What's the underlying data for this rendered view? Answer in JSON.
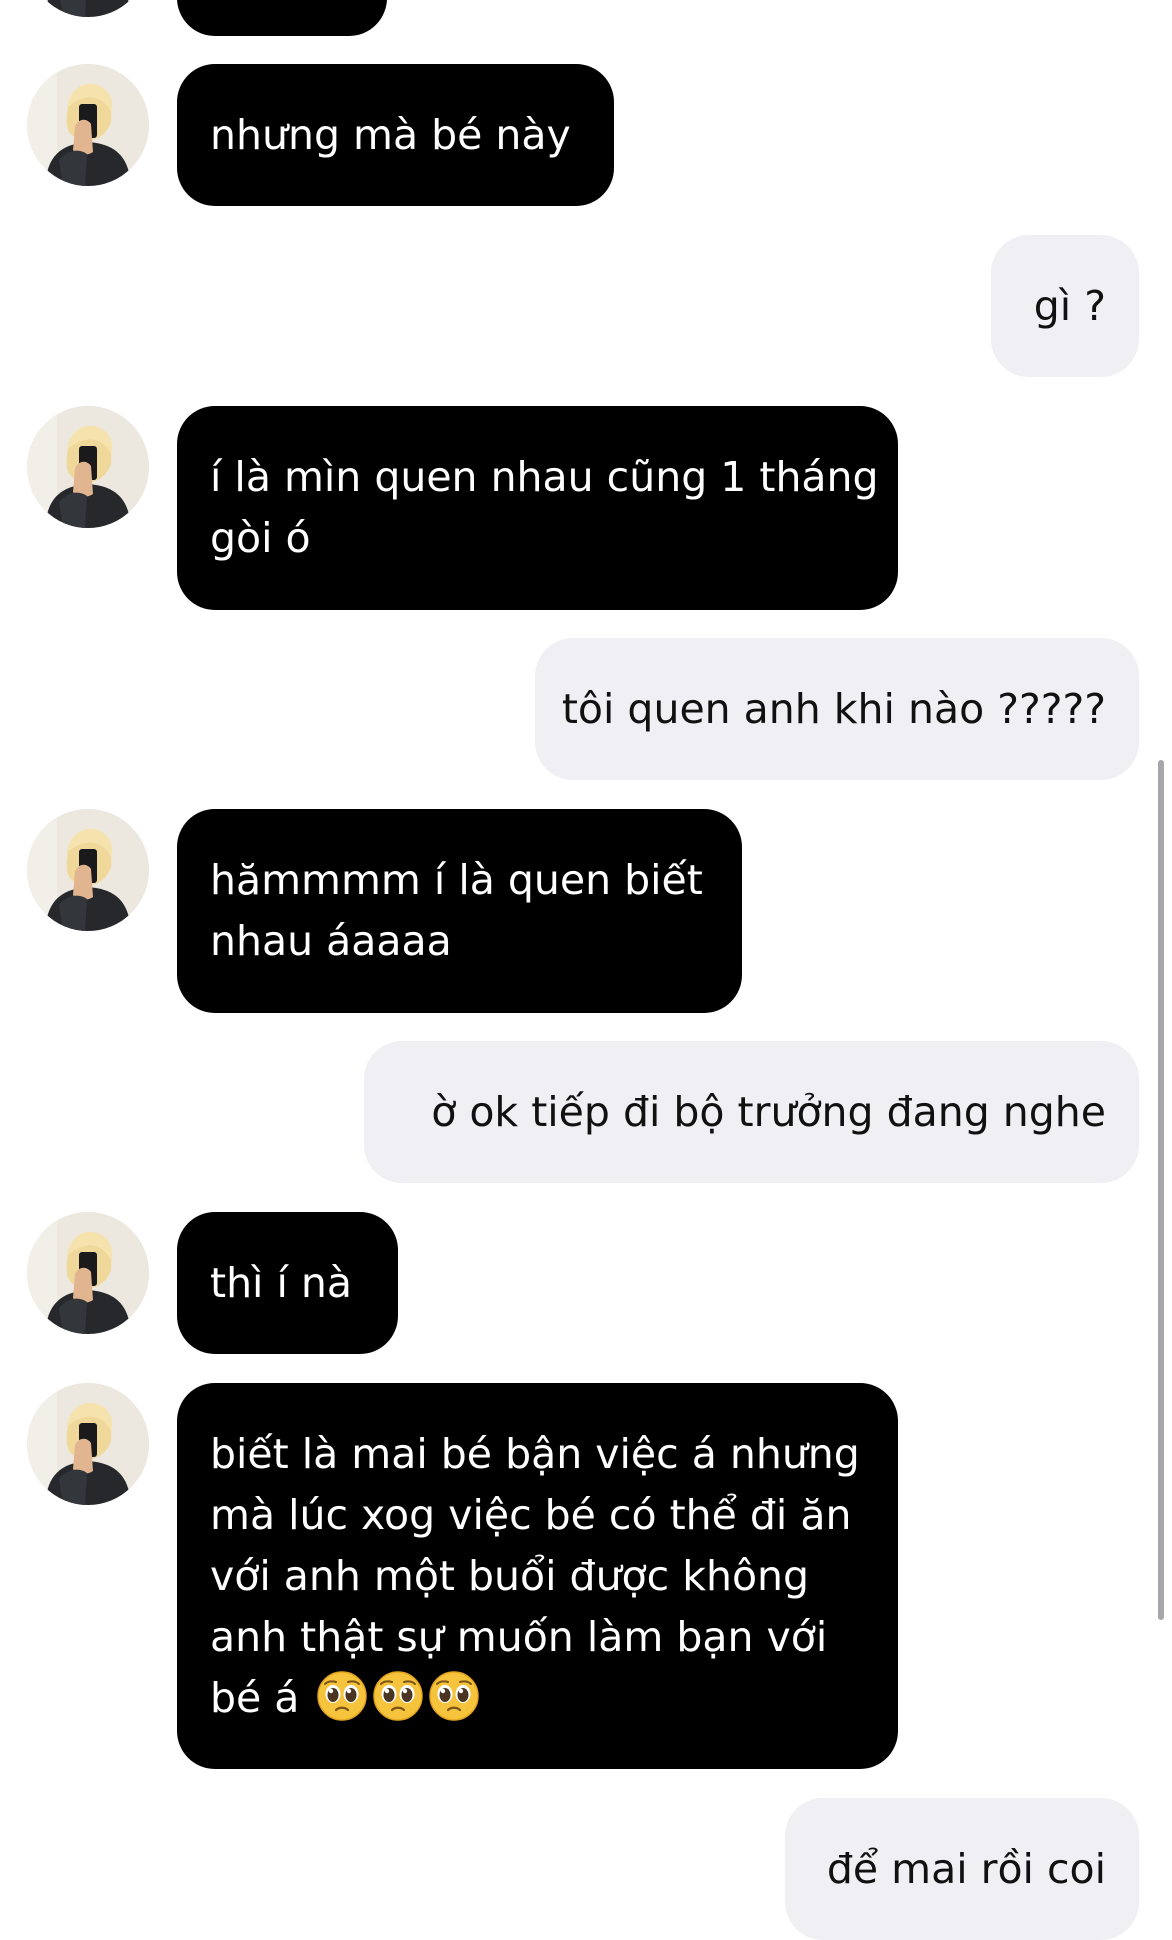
{
  "conversation": {
    "messages": [
      {
        "sender": "them",
        "text": ""
      },
      {
        "sender": "them",
        "text": "nhưng mà bé này"
      },
      {
        "sender": "me",
        "text": "gì ?"
      },
      {
        "sender": "them",
        "line1": "í là mìn quen nhau cũng 1 tháng",
        "line2": "gòi ó"
      },
      {
        "sender": "me",
        "text": "tôi quen anh khi nào ?????"
      },
      {
        "sender": "them",
        "line1": "hămmmm í là quen biết",
        "line2": "nhau áaaaa"
      },
      {
        "sender": "me",
        "text": "ờ ok tiếp đi bộ trưởng đang nghe"
      },
      {
        "sender": "them",
        "text": "thì í nà"
      },
      {
        "sender": "them",
        "line1": "biết là mai bé bận việc á nhưng",
        "line2": "mà lúc xog việc bé có thể đi ăn",
        "line3": "với anh một buổi được không",
        "line4": "anh thật sự muốn làm bạn với",
        "line5": "bé á",
        "emojis": [
          "pleading-face",
          "pleading-face",
          "pleading-face"
        ]
      },
      {
        "sender": "me",
        "text": "để mai rồi coi"
      }
    ]
  },
  "theme": {
    "incoming_bubble": "#000000",
    "incoming_text": "#ffffff",
    "outgoing_bubble": "#efeff4",
    "outgoing_text": "#111111",
    "background": "#ffffff"
  }
}
